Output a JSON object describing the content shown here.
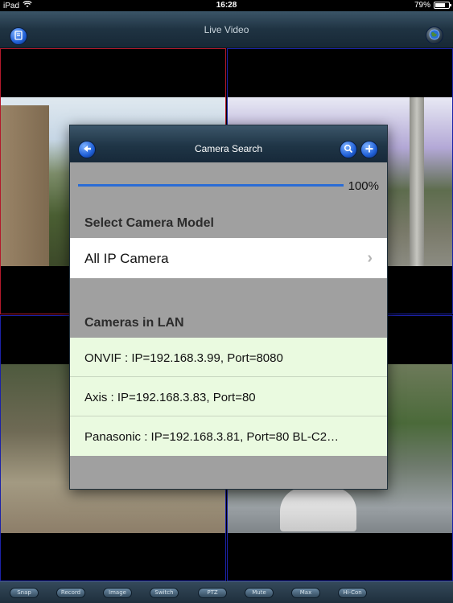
{
  "status_bar": {
    "carrier": "iPad",
    "time": "16:28",
    "battery_percent": "79%",
    "battery_level": 0.79
  },
  "top_bar": {
    "title": "Live Video",
    "left_icon": "menu-icon",
    "right_icon": "globe-icon"
  },
  "dialog": {
    "title": "Camera Search",
    "progress": {
      "value": 1.0,
      "label": "100%"
    },
    "select_model": {
      "header": "Select Camera Model",
      "value": "All IP Camera"
    },
    "lan": {
      "header": "Cameras in LAN",
      "items": [
        "ONVIF : IP=192.168.3.99, Port=8080",
        "Axis : IP=192.168.3.83, Port=80",
        "Panasonic : IP=192.168.3.81, Port=80  BL-C2…"
      ]
    }
  },
  "toolbar": {
    "buttons": [
      "Snap",
      "Record",
      "Image",
      "Switch",
      "PTZ",
      "Mute",
      "Max",
      "Hi-Con"
    ]
  },
  "colors": {
    "accent": "#2a6cd6",
    "lan_row_bg": "#eafae0",
    "selected_cell_border": "#b3192b",
    "cell_border": "#1c22a8"
  }
}
